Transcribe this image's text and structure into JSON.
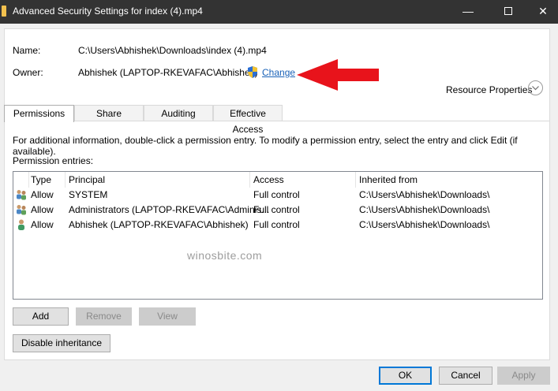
{
  "window": {
    "title": "Advanced Security Settings for index (4).mp4",
    "minimize": "—",
    "close": "✕"
  },
  "details": {
    "name_label": "Name:",
    "name_value": "C:\\Users\\Abhishek\\Downloads\\index (4).mp4",
    "owner_label": "Owner:",
    "owner_value": "Abhishek (LAPTOP-RKEVAFAC\\Abhishek)",
    "change_link": "Change",
    "resource_properties": "Resource Properties"
  },
  "tabs": [
    {
      "label": "Permissions",
      "active": true
    },
    {
      "label": "Share",
      "active": false
    },
    {
      "label": "Auditing",
      "active": false
    },
    {
      "label": "Effective Access",
      "active": false
    }
  ],
  "permissions": {
    "info_text": "For additional information, double-click a permission entry. To modify a permission entry, select the entry and click Edit (if available).",
    "entries_label": "Permission entries:",
    "columns": [
      "Type",
      "Principal",
      "Access",
      "Inherited from"
    ],
    "rows": [
      {
        "icon": "group-users-icon",
        "type": "Allow",
        "principal": "SYSTEM",
        "access": "Full control",
        "inherited_from": "C:\\Users\\Abhishek\\Downloads\\"
      },
      {
        "icon": "group-users-icon",
        "type": "Allow",
        "principal": "Administrators (LAPTOP-RKEVAFAC\\Adminis...",
        "access": "Full control",
        "inherited_from": "C:\\Users\\Abhishek\\Downloads\\"
      },
      {
        "icon": "single-user-icon",
        "type": "Allow",
        "principal": "Abhishek (LAPTOP-RKEVAFAC\\Abhishek)",
        "access": "Full control",
        "inherited_from": "C:\\Users\\Abhishek\\Downloads\\"
      }
    ],
    "watermark": "winosbite.com"
  },
  "buttons": {
    "add": "Add",
    "remove": "Remove",
    "view": "View",
    "disable_inheritance": "Disable inheritance",
    "ok": "OK",
    "cancel": "Cancel",
    "apply": "Apply"
  },
  "colors": {
    "title_bar": "#333333",
    "link": "#1a62b8",
    "arrow": "#e8131b",
    "default_button_border": "#0078d7"
  }
}
